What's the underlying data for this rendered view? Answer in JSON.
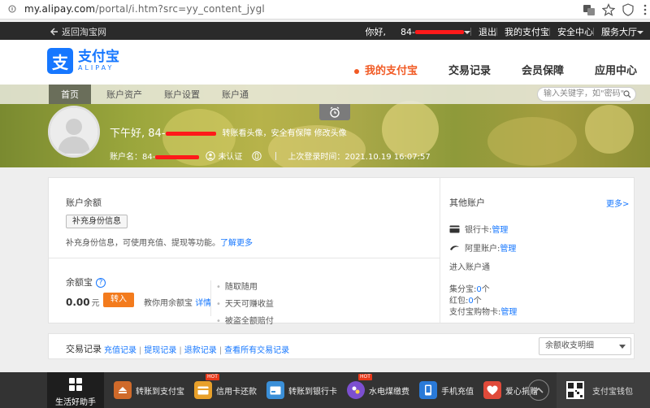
{
  "browser": {
    "url_host": "my.alipay.com",
    "url_path": "/portal/i.htm?src=yy_content_jygl"
  },
  "topbar": {
    "back_label": "返回淘宝网",
    "greeting": "你好,",
    "account_prefix": "84-",
    "logout": "退出",
    "my_alipay": "我的支付宝",
    "security_center": "安全中心",
    "service_hall": "服务大厅"
  },
  "logo": {
    "cn": "支付宝",
    "en": "ALIPAY",
    "mark": "支"
  },
  "mainnav": {
    "items": [
      "我的支付宝",
      "交易记录",
      "会员保障",
      "应用中心"
    ]
  },
  "subnav": {
    "tabs": [
      "首页",
      "账户资产",
      "账户设置",
      "账户通"
    ],
    "search_placeholder": "输入关键字，如\"密码\""
  },
  "profile": {
    "hello": "下午好, 84-",
    "hint_prefix": "转账看头像，安全有保障",
    "hint_link": "修改头像",
    "account_label": "账户名：84-",
    "verify_status": "未认证",
    "last_login": "上次登录时间：2021.10.19 16:07:57"
  },
  "balance": {
    "title": "账户余额",
    "fill_button": "补充身份信息",
    "desc": "补充身份信息，可使用充值、提现等功能。",
    "desc_link": "了解更多"
  },
  "yuebao": {
    "title": "余额宝",
    "help": "?",
    "amount": "0.00",
    "unit": "元",
    "transfer_in": "转入",
    "teach": "教你用余额宝",
    "detail": "详情",
    "bullets": [
      "随取随用",
      "天天可赚收益",
      "被盗全额赔付"
    ]
  },
  "other": {
    "title": "其他账户",
    "more": "更多>",
    "bank_card_label": "银行卡:",
    "bank_card_link": "管理",
    "ali_label": "阿里账户:",
    "ali_link": "管理",
    "account_link": "进入账户通",
    "jifen": "集分宝:",
    "jifen_val": "0",
    "jifen_unit": "个",
    "hongbao": "红包:",
    "hongbao_val": "0",
    "hongbao_unit": "个",
    "shopping": "支付宝购物卡:",
    "shopping_link": "管理"
  },
  "trade": {
    "title": "交易记录",
    "links": [
      "充值记录",
      "提现记录",
      "退款记录",
      "查看所有交易记录"
    ],
    "select_value": "余额收支明细"
  },
  "bottom": {
    "life": "生活好助手",
    "items": [
      {
        "label": "转账到支付宝",
        "color": "#d06a2a",
        "hot": ""
      },
      {
        "label": "信用卡还款",
        "color": "#e8a02a",
        "hot": "HOT"
      },
      {
        "label": "转账到银行卡",
        "color": "#3a8fd8",
        "hot": ""
      },
      {
        "label": "水电煤缴费",
        "color": "#7c4fd0",
        "hot": "HOT"
      },
      {
        "label": "手机充值",
        "color": "#2a7ad8",
        "hot": ""
      },
      {
        "label": "爱心捐赠",
        "color": "#e04a3a",
        "hot": ""
      }
    ],
    "wallet": "支付宝钱包"
  }
}
